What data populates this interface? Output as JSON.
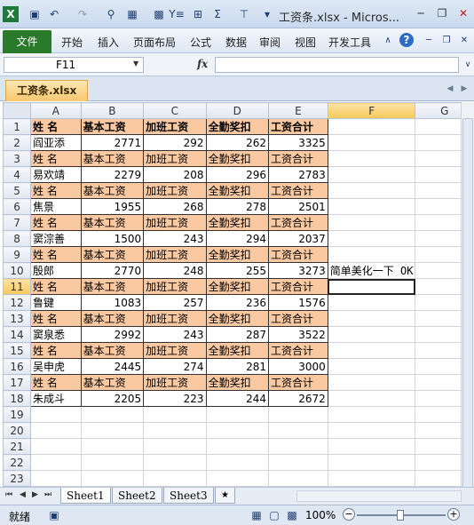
{
  "window": {
    "title": "工资条.xlsx - Micros...",
    "quick_access": [
      "excel-logo-icon",
      "save-icon",
      "undo-icon",
      "redo-icon",
      "print-preview-icon",
      "format-icon",
      "calculator-icon",
      "filter-icon",
      "borders-icon",
      "autosum-icon",
      "align-icon",
      "customize-icon"
    ]
  },
  "ribbon": {
    "file_label": "文件",
    "tabs": [
      "开始",
      "插入",
      "页面布局",
      "公式",
      "数据",
      "审阅",
      "视图",
      "开发工具"
    ]
  },
  "formula_bar": {
    "name_box": "F11",
    "fx_label": "fx",
    "formula": ""
  },
  "workbook_tab": "工资条.xlsx",
  "columns": [
    "A",
    "B",
    "C",
    "D",
    "E",
    "F",
    "G"
  ],
  "selected_column": "F",
  "selected_row": "11",
  "header_labels": [
    "姓  名",
    "基本工资",
    "加班工资",
    "全勤奖扣",
    "工资合计"
  ],
  "records": [
    {
      "row": "2",
      "name": "阎亚添",
      "base": "2771",
      "overtime": "292",
      "bonus": "262",
      "total": "3325"
    },
    {
      "row": "4",
      "name": "易欢靖",
      "base": "2279",
      "overtime": "208",
      "bonus": "296",
      "total": "2783"
    },
    {
      "row": "6",
      "name": "焦景",
      "base": "1955",
      "overtime": "268",
      "bonus": "278",
      "total": "2501"
    },
    {
      "row": "8",
      "name": "窦淙善",
      "base": "1500",
      "overtime": "243",
      "bonus": "294",
      "total": "2037"
    },
    {
      "row": "10",
      "name": "殷郎",
      "base": "2770",
      "overtime": "248",
      "bonus": "255",
      "total": "3273"
    },
    {
      "row": "12",
      "name": "鲁键",
      "base": "1083",
      "overtime": "257",
      "bonus": "236",
      "total": "1576"
    },
    {
      "row": "14",
      "name": "窦泉悉",
      "base": "2992",
      "overtime": "243",
      "bonus": "287",
      "total": "3522"
    },
    {
      "row": "16",
      "name": "吴申虎",
      "base": "2445",
      "overtime": "274",
      "bonus": "281",
      "total": "3000"
    },
    {
      "row": "18",
      "name": "朱成斗",
      "base": "2205",
      "overtime": "223",
      "bonus": "244",
      "total": "2672"
    }
  ],
  "header_rows": [
    "1",
    "3",
    "5",
    "7",
    "9",
    "11",
    "13",
    "15",
    "17"
  ],
  "empty_rows": [
    "19",
    "20",
    "21",
    "22",
    "23"
  ],
  "note": "简单美化一下  OK",
  "sheet_tabs": [
    "Sheet1",
    "Sheet2",
    "Sheet3"
  ],
  "active_sheet": "Sheet1",
  "status": {
    "ready": "就绪",
    "zoom": "100%"
  }
}
